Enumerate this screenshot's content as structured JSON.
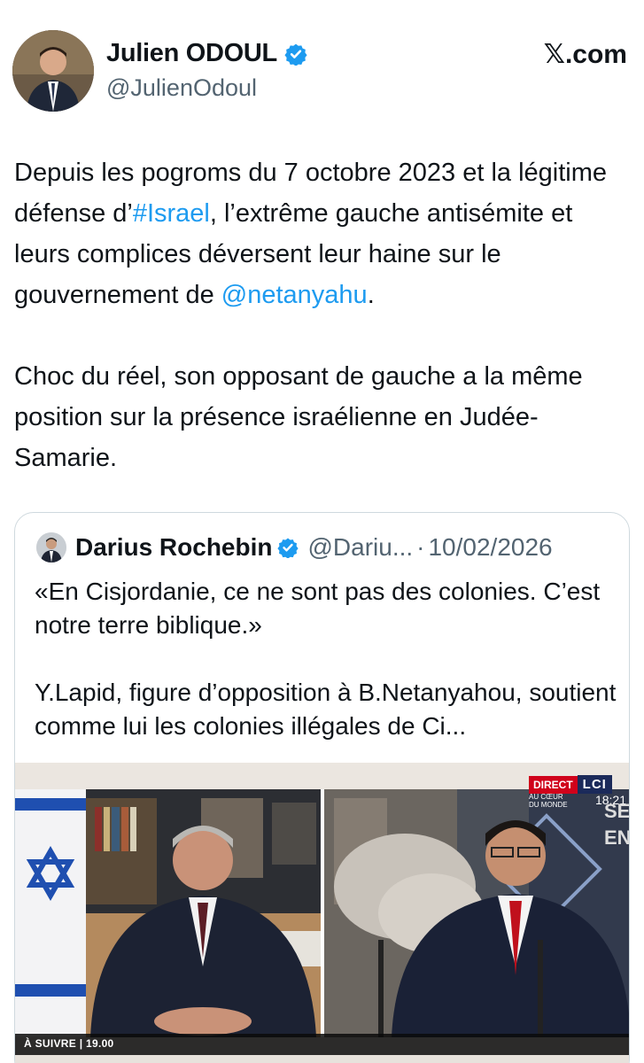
{
  "header": {
    "display_name": "Julien ODOUL",
    "handle": "@JulienOdoul",
    "brand": "𝕏.com",
    "verified_icon": "verified-badge-icon"
  },
  "tweet": {
    "paragraph1": {
      "before_tag": "Depuis les pogroms du 7 octobre 2023 et la légitime défense d’",
      "hashtag": "#Israel",
      "middle": ", l’extrême gauche antisémite et leurs complices déversent leur haine sur le gouvernement de ",
      "mention": "@netanyahu",
      "after": "."
    },
    "paragraph2": "Choc du réel, son opposant de gauche a la même position sur la présence israélienne en Judée-Samarie."
  },
  "quote": {
    "display_name": "Darius Rochebin",
    "handle": "@Dariu...",
    "separator": "·",
    "date": "10/02/2026",
    "paragraph1": "«En Cisjordanie, ce ne sont pas des colonies. C’est notre terre biblique.»",
    "paragraph2": "Y.Lapid, figure d’opposition à B.Netanyahou, soutient comme lui les colonies illégales de Ci..."
  },
  "media": {
    "direct_label": "DIRECT",
    "channel_logo": "LCI",
    "program_tag": "AU CŒUR DU MONDE",
    "clock": "18:21",
    "up_next": "À SUIVRE | 19.00",
    "side_text": "SE EN"
  },
  "colors": {
    "link": "#1d9bf0",
    "verified": "#1d9bf0",
    "secondary_text": "#536471",
    "border": "#cfd9de"
  }
}
